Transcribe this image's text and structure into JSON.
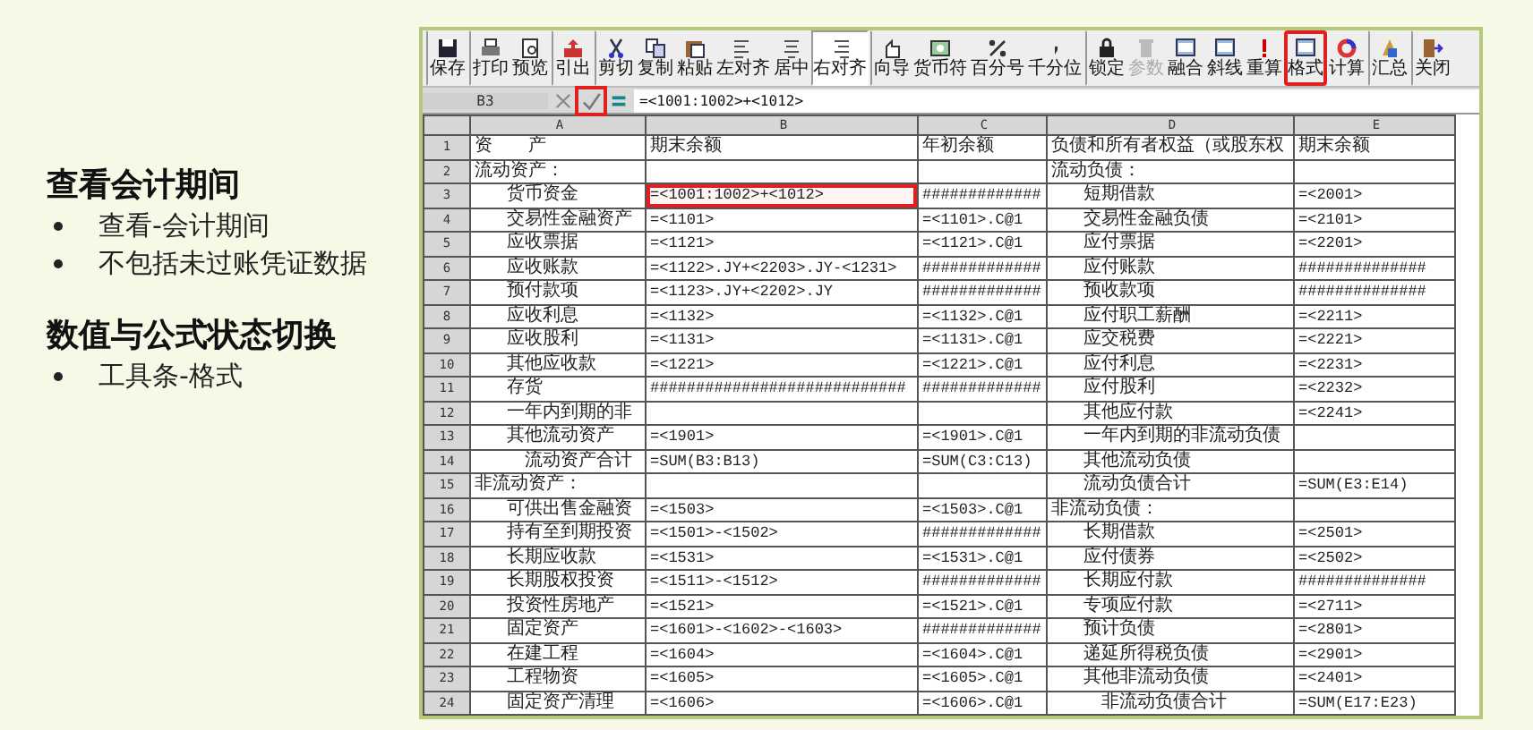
{
  "slide": {
    "sections": [
      {
        "heading": "查看会计期间",
        "bullets": [
          "查看-会计期间",
          "不包括未过账凭证数据"
        ]
      },
      {
        "heading": "数值与公式状态切换",
        "bullets": [
          "工具条-格式"
        ]
      }
    ]
  },
  "toolbar": {
    "buttons": [
      {
        "label": "保存",
        "pressed": false,
        "disabled": false,
        "highlighted": false,
        "group_start": true
      },
      {
        "label": "打印",
        "pressed": false,
        "disabled": false,
        "highlighted": false,
        "group_start": true
      },
      {
        "label": "预览",
        "pressed": false,
        "disabled": false,
        "highlighted": false,
        "group_start": false
      },
      {
        "label": "引出",
        "pressed": false,
        "disabled": false,
        "highlighted": false,
        "group_start": true
      },
      {
        "label": "剪切",
        "pressed": false,
        "disabled": false,
        "highlighted": false,
        "group_start": true
      },
      {
        "label": "复制",
        "pressed": false,
        "disabled": false,
        "highlighted": false,
        "group_start": false
      },
      {
        "label": "粘贴",
        "pressed": false,
        "disabled": false,
        "highlighted": false,
        "group_start": false
      },
      {
        "label": "左对齐",
        "pressed": false,
        "disabled": false,
        "highlighted": false,
        "group_start": false
      },
      {
        "label": "居中",
        "pressed": false,
        "disabled": false,
        "highlighted": false,
        "group_start": false
      },
      {
        "label": "右对齐",
        "pressed": true,
        "disabled": false,
        "highlighted": false,
        "group_start": false
      },
      {
        "label": "向导",
        "pressed": false,
        "disabled": false,
        "highlighted": false,
        "group_start": true
      },
      {
        "label": "货币符",
        "pressed": false,
        "disabled": false,
        "highlighted": false,
        "group_start": false
      },
      {
        "label": "百分号",
        "pressed": false,
        "disabled": false,
        "highlighted": false,
        "group_start": false
      },
      {
        "label": "千分位",
        "pressed": false,
        "disabled": false,
        "highlighted": false,
        "group_start": false
      },
      {
        "label": "锁定",
        "pressed": false,
        "disabled": false,
        "highlighted": false,
        "group_start": true
      },
      {
        "label": "参数",
        "pressed": false,
        "disabled": true,
        "highlighted": false,
        "group_start": false
      },
      {
        "label": "融合",
        "pressed": false,
        "disabled": false,
        "highlighted": false,
        "group_start": false
      },
      {
        "label": "斜线",
        "pressed": false,
        "disabled": false,
        "highlighted": false,
        "group_start": false
      },
      {
        "label": "重算",
        "pressed": false,
        "disabled": false,
        "highlighted": false,
        "group_start": false
      },
      {
        "label": "格式",
        "pressed": false,
        "disabled": false,
        "highlighted": true,
        "group_start": false
      },
      {
        "label": "计算",
        "pressed": false,
        "disabled": false,
        "highlighted": false,
        "group_start": false
      },
      {
        "label": "汇总",
        "pressed": false,
        "disabled": false,
        "highlighted": false,
        "group_start": true
      },
      {
        "label": "关闭",
        "pressed": false,
        "disabled": false,
        "highlighted": false,
        "group_start": true
      }
    ]
  },
  "formula_bar": {
    "cell_ref": "B3",
    "confirm_highlighted": true,
    "value": "=<1001:1002>+<1012>"
  },
  "table": {
    "columns": [
      "A",
      "B",
      "C",
      "D",
      "E"
    ],
    "rows": [
      {
        "number": "1",
        "cells": [
          {
            "text": "资　　产",
            "kind": "label",
            "selected": false
          },
          {
            "text": "期末余额",
            "kind": "label",
            "selected": false
          },
          {
            "text": "年初余额",
            "kind": "label",
            "selected": false
          },
          {
            "text": "负债和所有者权益（或股东权",
            "kind": "label",
            "selected": false
          },
          {
            "text": "期末余额",
            "kind": "label",
            "selected": false
          }
        ]
      },
      {
        "number": "2",
        "cells": [
          {
            "text": "流动资产：",
            "kind": "label",
            "selected": false
          },
          {
            "selected": false
          },
          {
            "selected": false
          },
          {
            "text": "流动负债：",
            "kind": "label",
            "selected": false
          },
          {
            "selected": false
          }
        ]
      },
      {
        "number": "3",
        "cells": [
          {
            "text": "货币资金",
            "kind": "item",
            "selected": false
          },
          {
            "text": "=<1001:1002>+<1012>",
            "kind": "formula",
            "selected": true
          },
          {
            "text": "#############",
            "kind": "formula",
            "selected": false
          },
          {
            "text": "短期借款",
            "kind": "item",
            "selected": false
          },
          {
            "text": "=<2001>",
            "kind": "formula",
            "selected": false
          }
        ]
      },
      {
        "number": "4",
        "cells": [
          {
            "text": "交易性金融资产",
            "kind": "item",
            "selected": false
          },
          {
            "text": "=<1101>",
            "kind": "formula",
            "selected": false
          },
          {
            "text": "=<1101>.C@1",
            "kind": "formula",
            "selected": false
          },
          {
            "text": "交易性金融负债",
            "kind": "item",
            "selected": false
          },
          {
            "text": "=<2101>",
            "kind": "formula",
            "selected": false
          }
        ]
      },
      {
        "number": "5",
        "cells": [
          {
            "text": "应收票据",
            "kind": "item",
            "selected": false
          },
          {
            "text": "=<1121>",
            "kind": "formula",
            "selected": false
          },
          {
            "text": "=<1121>.C@1",
            "kind": "formula",
            "selected": false
          },
          {
            "text": "应付票据",
            "kind": "item",
            "selected": false
          },
          {
            "text": "=<2201>",
            "kind": "formula",
            "selected": false
          }
        ]
      },
      {
        "number": "6",
        "cells": [
          {
            "text": "应收账款",
            "kind": "item",
            "selected": false
          },
          {
            "text": "=<1122>.JY+<2203>.JY-<1231>",
            "kind": "formula",
            "selected": false
          },
          {
            "text": "#############",
            "kind": "formula",
            "selected": false
          },
          {
            "text": "应付账款",
            "kind": "item",
            "selected": false
          },
          {
            "text": "##############",
            "kind": "formula",
            "selected": false
          }
        ]
      },
      {
        "number": "7",
        "cells": [
          {
            "text": "预付款项",
            "kind": "item",
            "selected": false
          },
          {
            "text": "=<1123>.JY+<2202>.JY",
            "kind": "formula",
            "selected": false
          },
          {
            "text": "#############",
            "kind": "formula",
            "selected": false
          },
          {
            "text": "预收款项",
            "kind": "item",
            "selected": false
          },
          {
            "text": "##############",
            "kind": "formula",
            "selected": false
          }
        ]
      },
      {
        "number": "8",
        "cells": [
          {
            "text": "应收利息",
            "kind": "item",
            "selected": false
          },
          {
            "text": "=<1132>",
            "kind": "formula",
            "selected": false
          },
          {
            "text": "=<1132>.C@1",
            "kind": "formula",
            "selected": false
          },
          {
            "text": "应付职工薪酬",
            "kind": "item",
            "selected": false
          },
          {
            "text": "=<2211>",
            "kind": "formula",
            "selected": false
          }
        ]
      },
      {
        "number": "9",
        "cells": [
          {
            "text": "应收股利",
            "kind": "item",
            "selected": false
          },
          {
            "text": "=<1131>",
            "kind": "formula",
            "selected": false
          },
          {
            "text": "=<1131>.C@1",
            "kind": "formula",
            "selected": false
          },
          {
            "text": "应交税费",
            "kind": "item",
            "selected": false
          },
          {
            "text": "=<2221>",
            "kind": "formula",
            "selected": false
          }
        ]
      },
      {
        "number": "10",
        "cells": [
          {
            "text": "其他应收款",
            "kind": "item",
            "selected": false
          },
          {
            "text": "=<1221>",
            "kind": "formula",
            "selected": false
          },
          {
            "text": "=<1221>.C@1",
            "kind": "formula",
            "selected": false
          },
          {
            "text": "应付利息",
            "kind": "item",
            "selected": false
          },
          {
            "text": "=<2231>",
            "kind": "formula",
            "selected": false
          }
        ]
      },
      {
        "number": "11",
        "cells": [
          {
            "text": "存货",
            "kind": "item",
            "selected": false
          },
          {
            "text": "############################",
            "kind": "formula",
            "selected": false
          },
          {
            "text": "#############",
            "kind": "formula",
            "selected": false
          },
          {
            "text": "应付股利",
            "kind": "item",
            "selected": false
          },
          {
            "text": "=<2232>",
            "kind": "formula",
            "selected": false
          }
        ]
      },
      {
        "number": "12",
        "cells": [
          {
            "text": "一年内到期的非",
            "kind": "item",
            "selected": false
          },
          {
            "selected": false
          },
          {
            "selected": false
          },
          {
            "text": "其他应付款",
            "kind": "item",
            "selected": false
          },
          {
            "text": "=<2241>",
            "kind": "formula",
            "selected": false
          }
        ]
      },
      {
        "number": "13",
        "cells": [
          {
            "text": "其他流动资产",
            "kind": "item",
            "selected": false
          },
          {
            "text": "=<1901>",
            "kind": "formula",
            "selected": false
          },
          {
            "text": "=<1901>.C@1",
            "kind": "formula",
            "selected": false
          },
          {
            "text": "一年内到期的非流动负债",
            "kind": "item",
            "selected": false
          },
          {
            "selected": false
          }
        ]
      },
      {
        "number": "14",
        "cells": [
          {
            "text": "流动资产合计",
            "kind": "total",
            "selected": false
          },
          {
            "text": "=SUM(B3:B13)",
            "kind": "formula",
            "selected": false
          },
          {
            "text": "=SUM(C3:C13)",
            "kind": "formula",
            "selected": false
          },
          {
            "text": "其他流动负债",
            "kind": "item",
            "selected": false
          },
          {
            "selected": false
          }
        ]
      },
      {
        "number": "15",
        "cells": [
          {
            "text": "非流动资产：",
            "kind": "label",
            "selected": false
          },
          {
            "selected": false
          },
          {
            "selected": false
          },
          {
            "text": "流动负债合计",
            "kind": "item",
            "selected": false
          },
          {
            "text": "=SUM(E3:E14)",
            "kind": "formula",
            "selected": false
          }
        ]
      },
      {
        "number": "16",
        "cells": [
          {
            "text": "可供出售金融资",
            "kind": "item",
            "selected": false
          },
          {
            "text": "=<1503>",
            "kind": "formula",
            "selected": false
          },
          {
            "text": "=<1503>.C@1",
            "kind": "formula",
            "selected": false
          },
          {
            "text": "非流动负债：",
            "kind": "label",
            "selected": false
          },
          {
            "selected": false
          }
        ]
      },
      {
        "number": "17",
        "cells": [
          {
            "text": "持有至到期投资",
            "kind": "item",
            "selected": false
          },
          {
            "text": "=<1501>-<1502>",
            "kind": "formula",
            "selected": false
          },
          {
            "text": "#############",
            "kind": "formula",
            "selected": false
          },
          {
            "text": "长期借款",
            "kind": "item",
            "selected": false
          },
          {
            "text": "=<2501>",
            "kind": "formula",
            "selected": false
          }
        ]
      },
      {
        "number": "18",
        "cells": [
          {
            "text": "长期应收款",
            "kind": "item",
            "selected": false
          },
          {
            "text": "=<1531>",
            "kind": "formula",
            "selected": false
          },
          {
            "text": "=<1531>.C@1",
            "kind": "formula",
            "selected": false
          },
          {
            "text": "应付债券",
            "kind": "item",
            "selected": false
          },
          {
            "text": "=<2502>",
            "kind": "formula",
            "selected": false
          }
        ]
      },
      {
        "number": "19",
        "cells": [
          {
            "text": "长期股权投资",
            "kind": "item",
            "selected": false
          },
          {
            "text": "=<1511>-<1512>",
            "kind": "formula",
            "selected": false
          },
          {
            "text": "#############",
            "kind": "formula",
            "selected": false
          },
          {
            "text": "长期应付款",
            "kind": "item",
            "selected": false
          },
          {
            "text": "##############",
            "kind": "formula",
            "selected": false
          }
        ]
      },
      {
        "number": "20",
        "cells": [
          {
            "text": "投资性房地产",
            "kind": "item",
            "selected": false
          },
          {
            "text": "=<1521>",
            "kind": "formula",
            "selected": false
          },
          {
            "text": "=<1521>.C@1",
            "kind": "formula",
            "selected": false
          },
          {
            "text": "专项应付款",
            "kind": "item",
            "selected": false
          },
          {
            "text": "=<2711>",
            "kind": "formula",
            "selected": false
          }
        ]
      },
      {
        "number": "21",
        "cells": [
          {
            "text": "固定资产",
            "kind": "item",
            "selected": false
          },
          {
            "text": "=<1601>-<1602>-<1603>",
            "kind": "formula",
            "selected": false
          },
          {
            "text": "#############",
            "kind": "formula",
            "selected": false
          },
          {
            "text": "预计负债",
            "kind": "item",
            "selected": false
          },
          {
            "text": "=<2801>",
            "kind": "formula",
            "selected": false
          }
        ]
      },
      {
        "number": "22",
        "cells": [
          {
            "text": "在建工程",
            "kind": "item",
            "selected": false
          },
          {
            "text": "=<1604>",
            "kind": "formula",
            "selected": false
          },
          {
            "text": "=<1604>.C@1",
            "kind": "formula",
            "selected": false
          },
          {
            "text": "递延所得税负债",
            "kind": "item",
            "selected": false
          },
          {
            "text": "=<2901>",
            "kind": "formula",
            "selected": false
          }
        ]
      },
      {
        "number": "23",
        "cells": [
          {
            "text": "工程物资",
            "kind": "item",
            "selected": false
          },
          {
            "text": "=<1605>",
            "kind": "formula",
            "selected": false
          },
          {
            "text": "=<1605>.C@1",
            "kind": "formula",
            "selected": false
          },
          {
            "text": "其他非流动负债",
            "kind": "item",
            "selected": false
          },
          {
            "text": "=<2401>",
            "kind": "formula",
            "selected": false
          }
        ]
      },
      {
        "number": "24",
        "cells": [
          {
            "text": "固定资产清理",
            "kind": "item",
            "selected": false
          },
          {
            "text": "=<1606>",
            "kind": "formula",
            "selected": false
          },
          {
            "text": "=<1606>.C@1",
            "kind": "formula",
            "selected": false
          },
          {
            "text": "非流动负债合计",
            "kind": "total",
            "selected": false
          },
          {
            "text": "=SUM(E17:E23)",
            "kind": "formula",
            "selected": false
          }
        ]
      }
    ]
  }
}
